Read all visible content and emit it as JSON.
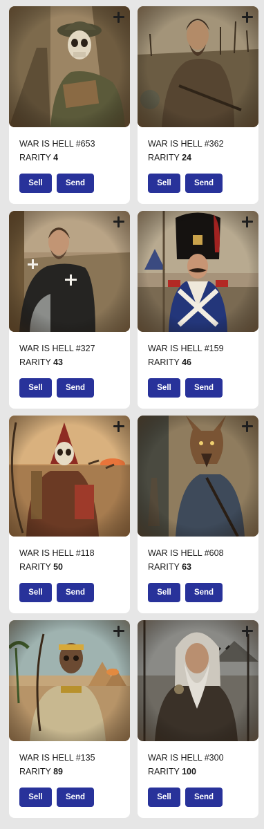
{
  "colors": {
    "page_background": "#e6e6e6",
    "card_background": "#ffffff",
    "button_background": "#28329a",
    "button_text": "#ffffff",
    "add_icon": "#1e1e1e"
  },
  "cards": [
    {
      "title": "WAR IS HELL #653",
      "rarity_label": "RARITY",
      "rarity_value": "4",
      "artwork": "skeleton-soldier-trench-artwork",
      "sell_label": "Sell",
      "send_label": "Send"
    },
    {
      "title": "WAR IS HELL #362",
      "rarity_label": "RARITY",
      "rarity_value": "24",
      "artwork": "ragged-soldier-battlefield-artwork",
      "sell_label": "Sell",
      "send_label": "Send"
    },
    {
      "title": "WAR IS HELL #327",
      "rarity_label": "RARITY",
      "rarity_value": "43",
      "artwork": "crusader-knight-artwork",
      "sell_label": "Sell",
      "send_label": "Send"
    },
    {
      "title": "WAR IS HELL #159",
      "rarity_label": "RARITY",
      "rarity_value": "46",
      "artwork": "bearskin-grenadier-artwork",
      "sell_label": "Sell",
      "send_label": "Send"
    },
    {
      "title": "WAR IS HELL #118",
      "rarity_label": "RARITY",
      "rarity_value": "50",
      "artwork": "skeleton-archer-desert-artwork",
      "sell_label": "Sell",
      "send_label": "Send"
    },
    {
      "title": "WAR IS HELL #608",
      "rarity_label": "RARITY",
      "rarity_value": "63",
      "artwork": "wolf-soldier-artwork",
      "sell_label": "Sell",
      "send_label": "Send"
    },
    {
      "title": "WAR IS HELL #135",
      "rarity_label": "RARITY",
      "rarity_value": "89",
      "artwork": "egyptian-undead-warrior-artwork",
      "sell_label": "Sell",
      "send_label": "Send"
    },
    {
      "title": "WAR IS HELL #300",
      "rarity_label": "RARITY",
      "rarity_value": "100",
      "artwork": "bearded-elder-warrior-artwork",
      "sell_label": "Sell",
      "send_label": "Send"
    }
  ]
}
